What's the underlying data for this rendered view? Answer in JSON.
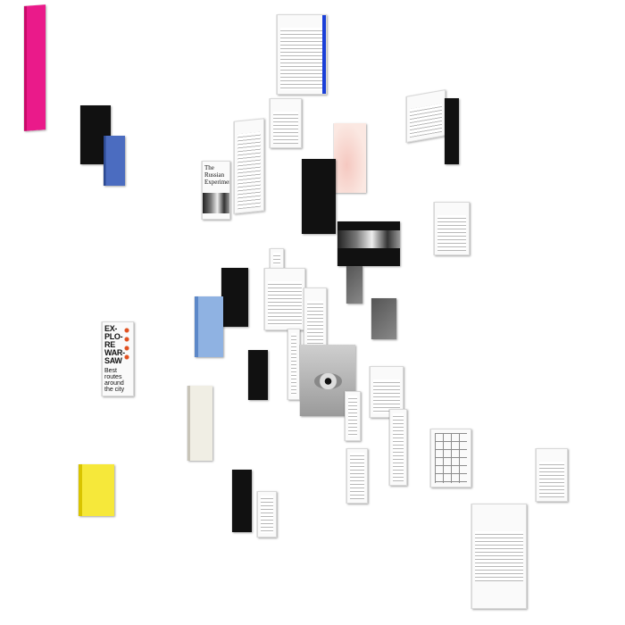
{
  "books": [
    {
      "id": "b01",
      "cover": "pink"
    },
    {
      "id": "b02",
      "cover": "black"
    },
    {
      "id": "b03",
      "cover": "blue"
    },
    {
      "id": "b04",
      "cover": "white",
      "variant": "barcode-page"
    },
    {
      "id": "b05",
      "cover": "white",
      "variant": "text"
    },
    {
      "id": "b06",
      "cover": "white",
      "variant": "text"
    },
    {
      "id": "b07",
      "cover": "white",
      "variant": "photo",
      "title": "The Russian Experiment"
    },
    {
      "id": "b08",
      "cover": "white",
      "variant": "text"
    },
    {
      "id": "b09",
      "cover": "pinkskin"
    },
    {
      "id": "b10",
      "cover": "black"
    },
    {
      "id": "b11",
      "cover": "white",
      "variant": "text"
    },
    {
      "id": "b12",
      "cover": "black"
    },
    {
      "id": "b13",
      "cover": "white",
      "variant": "text"
    },
    {
      "id": "b14",
      "cover": "white",
      "variant": "strip"
    },
    {
      "id": "b15",
      "cover": "white",
      "variant": "text"
    },
    {
      "id": "b16",
      "cover": "black"
    },
    {
      "id": "b17",
      "cover": "lightblue"
    },
    {
      "id": "b18",
      "cover": "white",
      "variant": "text"
    },
    {
      "id": "b19",
      "cover": "white",
      "variant": "text"
    },
    {
      "id": "b20",
      "cover": "gray"
    },
    {
      "id": "b21",
      "cover": "black"
    },
    {
      "id": "b22",
      "cover": "white",
      "variant": "map",
      "title": "EX-PLO-RE WAR-SAW",
      "subtitle": "Best routes around the city"
    },
    {
      "id": "b23",
      "cover": "white",
      "variant": "eye"
    },
    {
      "id": "b24",
      "cover": "black"
    },
    {
      "id": "b25",
      "cover": "white",
      "variant": "text"
    },
    {
      "id": "b26",
      "cover": "white",
      "variant": "text"
    },
    {
      "id": "b27",
      "cover": "cream"
    },
    {
      "id": "b28",
      "cover": "white",
      "variant": "grid"
    },
    {
      "id": "b29",
      "cover": "white",
      "variant": "text"
    },
    {
      "id": "b30",
      "cover": "white",
      "variant": "text"
    },
    {
      "id": "b31",
      "cover": "yellow"
    },
    {
      "id": "b32",
      "cover": "black"
    },
    {
      "id": "b33",
      "cover": "white",
      "variant": "text"
    },
    {
      "id": "b34",
      "cover": "white",
      "variant": "text"
    },
    {
      "id": "b35",
      "cover": "white",
      "variant": "text"
    }
  ]
}
